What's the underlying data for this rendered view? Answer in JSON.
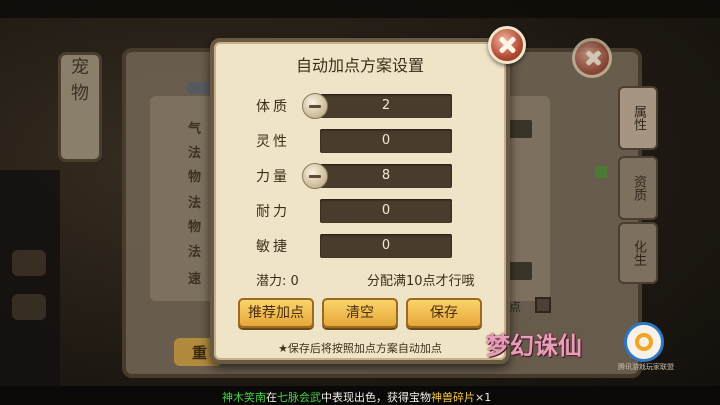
{
  "dialog": {
    "title": "自动加点方案设置",
    "stats": [
      {
        "label": "体质",
        "value": "2",
        "has_minus": true
      },
      {
        "label": "灵性",
        "value": "0",
        "has_minus": false
      },
      {
        "label": "力量",
        "value": "8",
        "has_minus": true
      },
      {
        "label": "耐力",
        "value": "0",
        "has_minus": false
      },
      {
        "label": "敏捷",
        "value": "0",
        "has_minus": false
      }
    ],
    "potential": "潜力: 0",
    "allocate_hint": "分配满10点才行哦",
    "buttons": {
      "recommend": "推荐加点",
      "clear": "清空",
      "save": "保存"
    },
    "footnote": "★保存后将按照加点方案自动加点"
  },
  "background": {
    "left_scroll_text": [
      "宠",
      "物"
    ],
    "attr_labels": [
      "气",
      "法",
      "物",
      "法",
      "物",
      "法",
      "速"
    ],
    "side_tabs": [
      "属性",
      "资质",
      "化生"
    ],
    "bottom_button": "重",
    "checkbox_label": "点"
  },
  "logos": {
    "game_logo_text": "梦幻诛仙",
    "publisher_text": "腾讯游戏玩家联盟"
  },
  "ticker": {
    "name": "神木笑南",
    "pre": "在",
    "event": "七脉会武",
    "mid": "中表现出色，获得宝物",
    "item": "神兽碎片",
    "count": "×1"
  },
  "colors": {
    "dialog_bg": "#f0e4c8",
    "button_gold": "#f3c04f",
    "close_red": "#b34a33",
    "ticker_green": "#46d24a",
    "ticker_yellow": "#f1c640"
  },
  "icons": [
    "close-icon",
    "minus-icon",
    "game-logo",
    "publisher-logo"
  ]
}
